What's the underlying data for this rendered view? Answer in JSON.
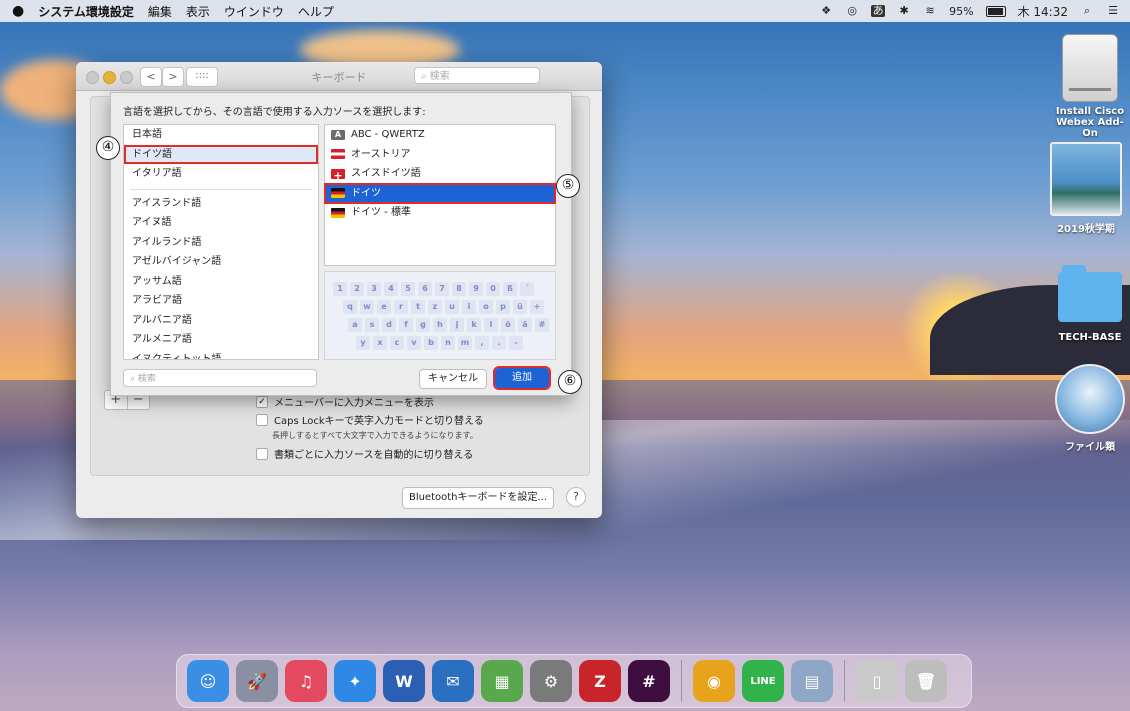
{
  "menubar": {
    "apple": "",
    "items": [
      "システム環境設定",
      "編集",
      "表示",
      "ウインドウ",
      "ヘルプ"
    ],
    "status": {
      "battery_percent": "95%",
      "clock": "木 14:32"
    },
    "status_icons": [
      "dropbox-icon",
      "creative-cloud-icon",
      "input-method-icon",
      "bluetooth-icon",
      "wifi-icon",
      "battery-icon",
      "spotlight-icon",
      "notification-center-icon"
    ]
  },
  "desktop": {
    "icons": [
      {
        "label": "Install Cisco Webex Add-On",
        "kind": "drive"
      },
      {
        "label": "2019秋学期",
        "kind": "photo"
      },
      {
        "label": "TECH-BASE",
        "kind": "folder"
      },
      {
        "label": "ファイル類",
        "kind": "photo-circle"
      }
    ]
  },
  "window": {
    "title": "キーボード",
    "search_placeholder": "検索",
    "nav_back": "<",
    "nav_forward": ">",
    "grid": "::::",
    "plus": "+",
    "minus": "−",
    "options": [
      {
        "label": "メニューバーに入力メニューを表示",
        "checked": true
      },
      {
        "label": "Caps Lockキーで英字入力モードと切り替える",
        "checked": false
      },
      {
        "label": "書類ごとに入力ソースを自動的に切り替える",
        "checked": false
      }
    ],
    "caps_note": "長押しするとすべて大文字で入力できるようになります。",
    "bluetooth_button": "Bluetoothキーボードを設定...",
    "help": "?"
  },
  "sheet": {
    "instruction": "言語を選択してから、その言語で使用する入力ソースを選択します:",
    "languages_top": [
      "日本語",
      "ドイツ語",
      "イタリア語"
    ],
    "languages": [
      "アイスランド語",
      "アイヌ語",
      "アイルランド語",
      "アゼルバイジャン語",
      "アッサム語",
      "アラビア語",
      "アルバニア語",
      "アルメニア語",
      "イヌクティトット語"
    ],
    "selected_language": "ドイツ語",
    "sources": [
      {
        "label": "ABC - QWERTZ",
        "flag": "abc"
      },
      {
        "label": "オーストリア",
        "flag": "at"
      },
      {
        "label": "スイスドイツ語",
        "flag": "ch"
      },
      {
        "label": "ドイツ",
        "flag": "de",
        "selected": true
      },
      {
        "label": "ドイツ - 標準",
        "flag": "de"
      }
    ],
    "keyboard_rows": [
      [
        "1",
        "2",
        "3",
        "4",
        "5",
        "6",
        "7",
        "8",
        "9",
        "0",
        "ß",
        "´"
      ],
      [
        "q",
        "w",
        "e",
        "r",
        "t",
        "z",
        "u",
        "i",
        "o",
        "p",
        "ü",
        "+"
      ],
      [
        "a",
        "s",
        "d",
        "f",
        "g",
        "h",
        "j",
        "k",
        "l",
        "ö",
        "ä",
        "#"
      ],
      [
        "y",
        "x",
        "c",
        "v",
        "b",
        "n",
        "m",
        ",",
        ".",
        "-"
      ]
    ],
    "search_placeholder": "検索",
    "cancel": "キャンセル",
    "add": "追加"
  },
  "steps": {
    "four": "④",
    "five": "⑤",
    "six": "⑥"
  },
  "dock": {
    "apps": [
      {
        "name": "finder",
        "glyph": "☺",
        "color": "#3a8ee6"
      },
      {
        "name": "launchpad",
        "glyph": "🚀",
        "color": "#8a8fa3"
      },
      {
        "name": "music",
        "glyph": "♫",
        "color": "#e3495f"
      },
      {
        "name": "safari",
        "glyph": "✦",
        "color": "#2d88e6"
      },
      {
        "name": "word",
        "glyph": "W",
        "color": "#2b5fb4"
      },
      {
        "name": "thunderbird",
        "glyph": "✉",
        "color": "#2b6fc0"
      },
      {
        "name": "photos-tool",
        "glyph": "▦",
        "color": "#5aa84e"
      },
      {
        "name": "system-preferences",
        "glyph": "⚙",
        "color": "#7a7a7a"
      },
      {
        "name": "filezilla",
        "glyph": "Z",
        "color": "#c8242a"
      },
      {
        "name": "slack",
        "glyph": "#",
        "color": "#3f0e40"
      },
      {
        "name": "chrome",
        "glyph": "◉",
        "color": "#e8a31c"
      },
      {
        "name": "line",
        "glyph": "LINE",
        "color": "#32b24a"
      },
      {
        "name": "preview",
        "glyph": "▤",
        "color": "#8fa7c7"
      },
      {
        "name": "documents",
        "glyph": "▯",
        "color": "#c9c9c9"
      },
      {
        "name": "trash",
        "glyph": "🗑",
        "color": "#bdbdbd"
      }
    ]
  }
}
